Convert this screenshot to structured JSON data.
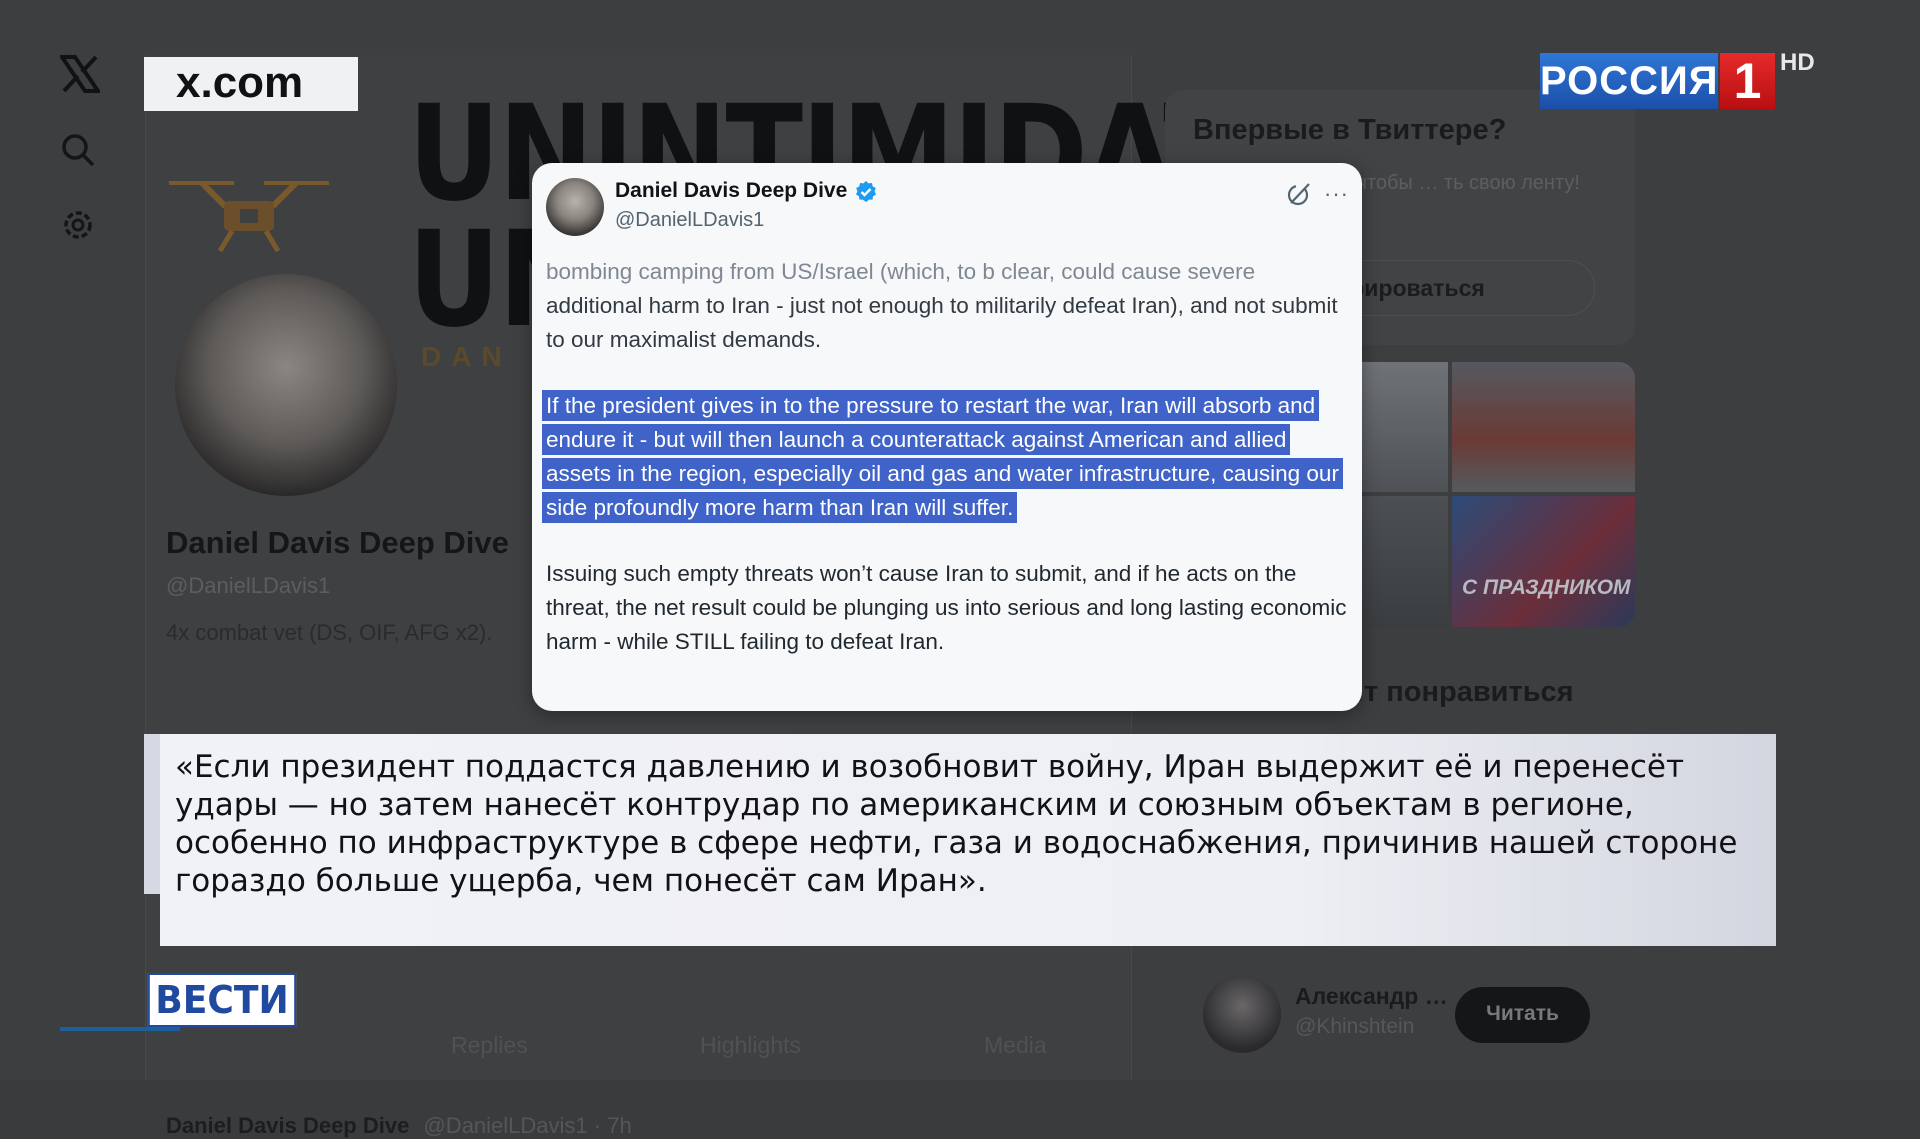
{
  "overlay": {
    "site_label": "x.com",
    "channel": {
      "name": "РОССИЯ",
      "number": "1",
      "quality": "HD"
    },
    "program": "ВЕСТИ",
    "subtitle": "«Если президент поддастся давлению и возобновит войну, Иран выдержит её и перенесёт удары — но затем нанесёт контрудар по американским и союзным объектам в регионе, особенно по инфраструктуре в сфере нефти, газа и водоснабжения, причинив нашей стороне гораздо больше ущерба, чем понесёт сам Иран»."
  },
  "nav": {
    "icons": [
      "x-logo-icon",
      "search-icon",
      "settings-icon"
    ]
  },
  "profile": {
    "banner_line1": "UNINTIMIDATED",
    "banner_line2": "UNC",
    "banner_sub": "DAN",
    "name": "Daniel Davis Deep Dive",
    "handle": "@DanielLDavis1",
    "bio": "4x combat vet (DS, OIF, AFG x2).",
    "tabs": [
      "Replies",
      "Highlights",
      "Media"
    ],
    "tweet_row": {
      "name": "Daniel Davis Deep Dive",
      "handle_time": "@DanielLDavis1 · 7h"
    }
  },
  "sidebar": {
    "new_title": "Впервые в Твиттере?",
    "new_sub": "… прямо сейчас, чтобы … ть свою ленту!",
    "register_label": "…стрироваться",
    "promo_text": "С ПРАЗДНИКОМ",
    "like_title": "…т понравиться",
    "follow": {
      "name": "Александр …",
      "handle": "@Khinshtein",
      "button": "Читать"
    }
  },
  "tweet": {
    "name": "Daniel Davis Deep Dive",
    "handle": "@DanielLDavis1",
    "para1_faded": "bombing camping from US/Israel (which, to b clear, could cause severe",
    "para1_rest": "additional harm to Iran - just not enough to militarily defeat Iran), and not submit to our maximalist demands.",
    "para2_highlighted": "If the president gives in to the pressure to restart the war, Iran will absorb and endure it - but will then launch a counterattack against American and allied assets in the region, especially oil and gas and water infrastructure, causing our side profoundly more harm than Iran will suffer.",
    "para3": "Issuing such empty threats won’t cause Iran to submit, and if he acts on the threat, the net result could be plunging us into serious and long lasting economic harm - while STILL failing to defeat Iran."
  },
  "colors": {
    "highlight": "#3f63c8",
    "verified": "#1d9bf0",
    "channel_blue": "#2f77d6",
    "channel_red": "#e62a2a",
    "vesti_blue": "#1f4aa0"
  }
}
